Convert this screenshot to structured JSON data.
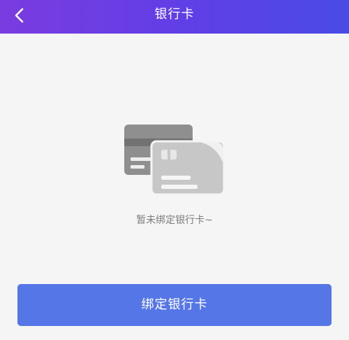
{
  "header": {
    "title": "银行卡",
    "back_icon": "chevron-left-icon"
  },
  "empty_state": {
    "illustration": "bank-cards-illustration",
    "message": "暂未绑定银行卡~"
  },
  "footer": {
    "bind_button_label": "绑定银行卡"
  },
  "colors": {
    "nav_gradient_start": "#7a3ce0",
    "nav_gradient_end": "#4a4be6",
    "button": "#5576e6",
    "background": "#f5f5f5",
    "message_text": "#7c7c7c"
  }
}
